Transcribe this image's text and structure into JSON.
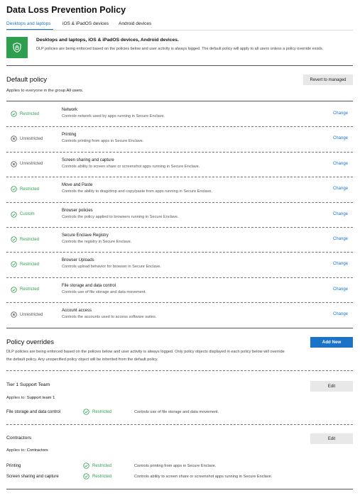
{
  "page": {
    "title": "Data Loss Prevention Policy"
  },
  "tabs": [
    {
      "label": "Desktops and laptops",
      "active": true
    },
    {
      "label": "iOS & iPadOS devices",
      "active": false
    },
    {
      "label": "Android devices",
      "active": false
    }
  ],
  "banner": {
    "icon": "shield-lock-icon",
    "title": "Desktops and laptops, iOS & iPadOS devices, Android devices.",
    "description": "DLP policies are being enforced based on the policies below and user activity is always logged. The default policy will apply to all users unless a policy override exists."
  },
  "default_policy": {
    "title": "Default policy",
    "revert_label": "Revert to managed",
    "applies_prefix": "Applies to everyone in the group",
    "applies_group": "All users.",
    "change_label": "Change",
    "rows": [
      {
        "status": "Restricted",
        "state": "restricted",
        "name": "Network",
        "description": "Controls network used by apps running in Secure Enclave."
      },
      {
        "status": "Unrestricted",
        "state": "unrestricted",
        "name": "Printing",
        "description": "Controls printing from apps in Secure Enclave."
      },
      {
        "status": "Unrestricted",
        "state": "unrestricted",
        "name": "Screen sharing and capture",
        "description": "Controls ability to screen share or screenshot apps running in Secure Enclave."
      },
      {
        "status": "Restricted",
        "state": "restricted",
        "name": "Move and Paste",
        "description": "Controls the ability to drag/drop and copy/paste from apps running in Secure Enclave."
      },
      {
        "status": "Custom",
        "state": "restricted",
        "name": "Browser policies",
        "description": "Controls the policy applied to browsers running in Secure Enclave."
      },
      {
        "status": "Restricted",
        "state": "restricted",
        "name": "Secure Enclave Registry",
        "description": "Controls the registry in Secure Enclave."
      },
      {
        "status": "Restricted",
        "state": "restricted",
        "name": "Browser Uploads",
        "description": "Controls upload behavior for browser in Secure Enclave."
      },
      {
        "status": "Restricted",
        "state": "restricted",
        "name": "File storage and data control",
        "description": "Controls use of file storage and data movement."
      },
      {
        "status": "Unrestricted",
        "state": "unrestricted",
        "name": "Account access",
        "description": "Controls the accounts used to access software suites."
      }
    ]
  },
  "overrides": {
    "title": "Policy overrides",
    "add_label": "Add New",
    "description": "DLP policies are being enforced based on the policies below and user activity is always logged. Only policy objects displayed in each policy below will override the default policy. Any unspecified policy object will be inherited from the default policy.",
    "edit_label": "Edit",
    "applies_prefix": "Applies to:",
    "groups": [
      {
        "name": "Tier 1 Support Team",
        "applies_to": "Support team 1",
        "rows": [
          {
            "name": "File storage and data control",
            "status": "Restricted",
            "description": "Controls use of file storage and data movement."
          }
        ]
      },
      {
        "name": "Contractors",
        "applies_to": "Contractors",
        "rows": [
          {
            "name": "Printing",
            "status": "Restricted",
            "description": "Controls printing from apps in Secure Enclave."
          },
          {
            "name": "Screen sharing and capture",
            "status": "Restricted",
            "description": "Controls ability to screen share or screenshot apps running in Secure Enclave."
          }
        ]
      }
    ]
  },
  "colors": {
    "accent": "#1a73c8",
    "ok": "#2e9e4f",
    "neutral": "#555555"
  }
}
